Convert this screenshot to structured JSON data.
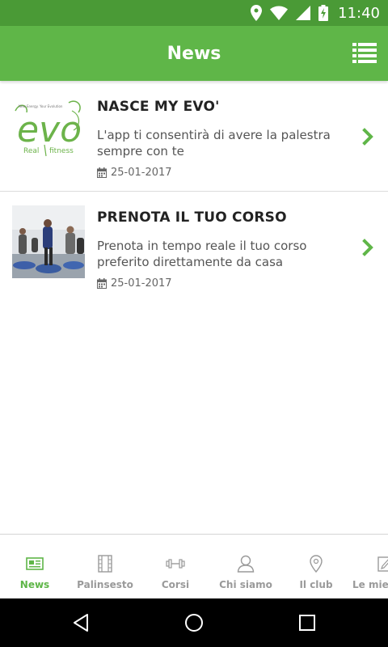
{
  "status_bar": {
    "time": "11:40",
    "icons": [
      "location-icon",
      "wifi-icon",
      "signal-icon",
      "battery-charging-icon"
    ]
  },
  "app_bar": {
    "title": "News",
    "menu_icon": "list-view-icon"
  },
  "news": [
    {
      "title": "NASCE MY EVO'",
      "description": "L'app ti consentirà di avere la palestra sempre con te",
      "date": "25-01-2017",
      "thumbnail": "evo-logo"
    },
    {
      "title": "PRENOTA IL TUO CORSO",
      "description": "Prenota in tempo reale il tuo corso preferito direttamente da casa",
      "date": "25-01-2017",
      "thumbnail": "fitness-class-photo"
    }
  ],
  "bottom_nav": {
    "items": [
      {
        "label": "News",
        "icon": "newspaper-icon",
        "active": true
      },
      {
        "label": "Palinsesto",
        "icon": "film-icon",
        "active": false
      },
      {
        "label": "Corsi",
        "icon": "dumbbell-icon",
        "active": false
      },
      {
        "label": "Chi siamo",
        "icon": "person-icon",
        "active": false
      },
      {
        "label": "Il club",
        "icon": "map-pin-icon",
        "active": false
      },
      {
        "label": "Le mie p",
        "icon": "edit-icon",
        "active": false
      }
    ]
  },
  "colors": {
    "primary": "#5fb648",
    "status_bar": "#4a9a36",
    "text": "#222222",
    "inactive": "#9a9a9a"
  }
}
